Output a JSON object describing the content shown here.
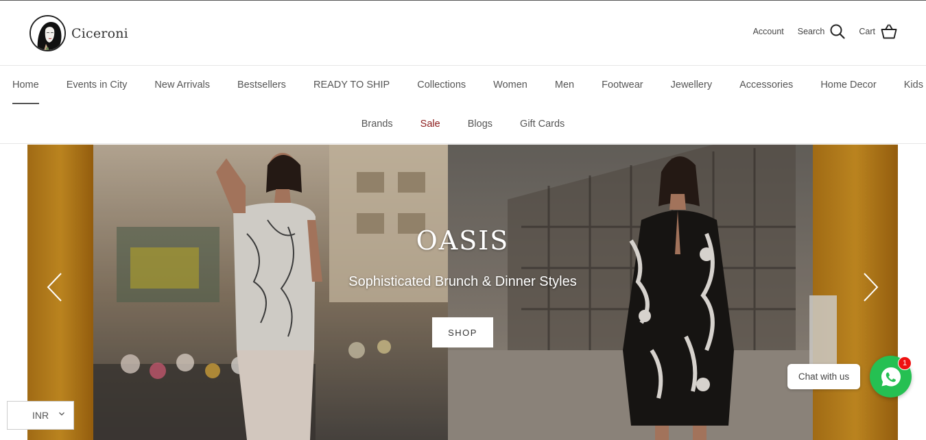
{
  "brand": {
    "name": "Ciceroni"
  },
  "header": {
    "account_label": "Account",
    "search_label": "Search",
    "cart_label": "Cart"
  },
  "nav": {
    "row1": [
      "Home",
      "Events in City",
      "New Arrivals",
      "Bestsellers",
      "READY TO SHIP",
      "Collections",
      "Women",
      "Men",
      "Footwear",
      "Jewellery",
      "Accessories",
      "Home Decor",
      "Kids"
    ],
    "row2": [
      "Brands",
      "Sale",
      "Blogs",
      "Gift Cards"
    ],
    "active": "Home",
    "sale_color": "#8b1a1a"
  },
  "hero": {
    "title": "OASIS",
    "subtitle": "Sophisticated Brunch & Dinner Styles",
    "cta_label": "SHOP",
    "icons": {
      "prev": "chevron-left-icon",
      "next": "chevron-right-icon"
    }
  },
  "currency": {
    "selected": "INR"
  },
  "chat": {
    "label": "Chat with us",
    "badge_count": "1",
    "icon": "whatsapp-icon",
    "color": "#25c052"
  }
}
